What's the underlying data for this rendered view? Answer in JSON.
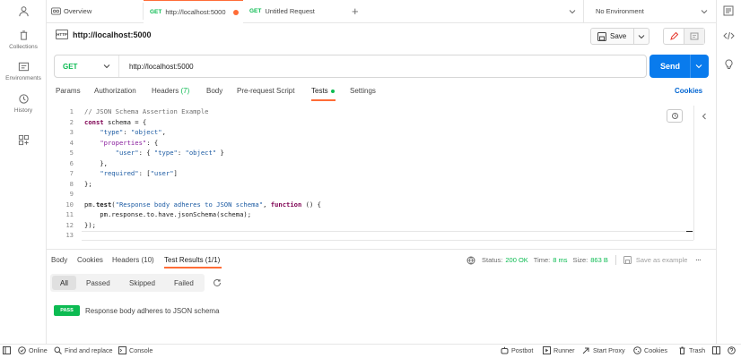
{
  "sidebar": {
    "items": [
      {
        "label": "",
        "icon": "user-icon"
      },
      {
        "label": "Collections",
        "icon": "trash-can-icon"
      },
      {
        "label": "Environments",
        "icon": "environment-icon"
      },
      {
        "label": "History",
        "icon": "history-icon"
      },
      {
        "label": "",
        "icon": "grid-plus-icon"
      }
    ]
  },
  "tabs": {
    "overview": "Overview",
    "active_method": "GET",
    "active_label": "http://localhost:5000",
    "second_method": "GET",
    "second_label": "Untitled Request",
    "new_tab": "+",
    "environment": "No Environment"
  },
  "request": {
    "name": "http://localhost:5000",
    "save_label": "Save",
    "method": "GET",
    "url": "http://localhost:5000",
    "send_label": "Send"
  },
  "subtabs": {
    "params": "Params",
    "authorization": "Authorization",
    "headers": "Headers",
    "headers_count": "(7)",
    "body": "Body",
    "prerequest": "Pre-request Script",
    "tests": "Tests",
    "settings": "Settings",
    "cookies": "Cookies"
  },
  "editor": {
    "line_numbers": [
      "1",
      "2",
      "3",
      "4",
      "5",
      "6",
      "7",
      "8",
      "9",
      "10",
      "11",
      "12",
      "13"
    ]
  },
  "response": {
    "tabs": {
      "body": "Body",
      "cookies": "Cookies",
      "headers": "Headers (10)",
      "test_results": "Test Results (1/1)"
    },
    "status_label": "Status:",
    "status_value": "200 OK",
    "time_label": "Time:",
    "time_value": "8 ms",
    "size_label": "Size:",
    "size_value": "863 B",
    "save_example": "Save as example",
    "filters": {
      "all": "All",
      "passed": "Passed",
      "skipped": "Skipped",
      "failed": "Failed"
    },
    "result_badge": "PASS",
    "result_text": "Response body adheres to JSON schema"
  },
  "statusbar": {
    "online": "Online",
    "find_replace": "Find and replace",
    "console": "Console",
    "postbot": "Postbot",
    "runner": "Runner",
    "start_proxy": "Start Proxy",
    "cookies": "Cookies",
    "trash": "Trash"
  },
  "colors": {
    "accent_orange": "#ff6c37",
    "send_blue": "#097bed",
    "pass_green": "#0cbb52",
    "link_blue": "#0265d2"
  }
}
